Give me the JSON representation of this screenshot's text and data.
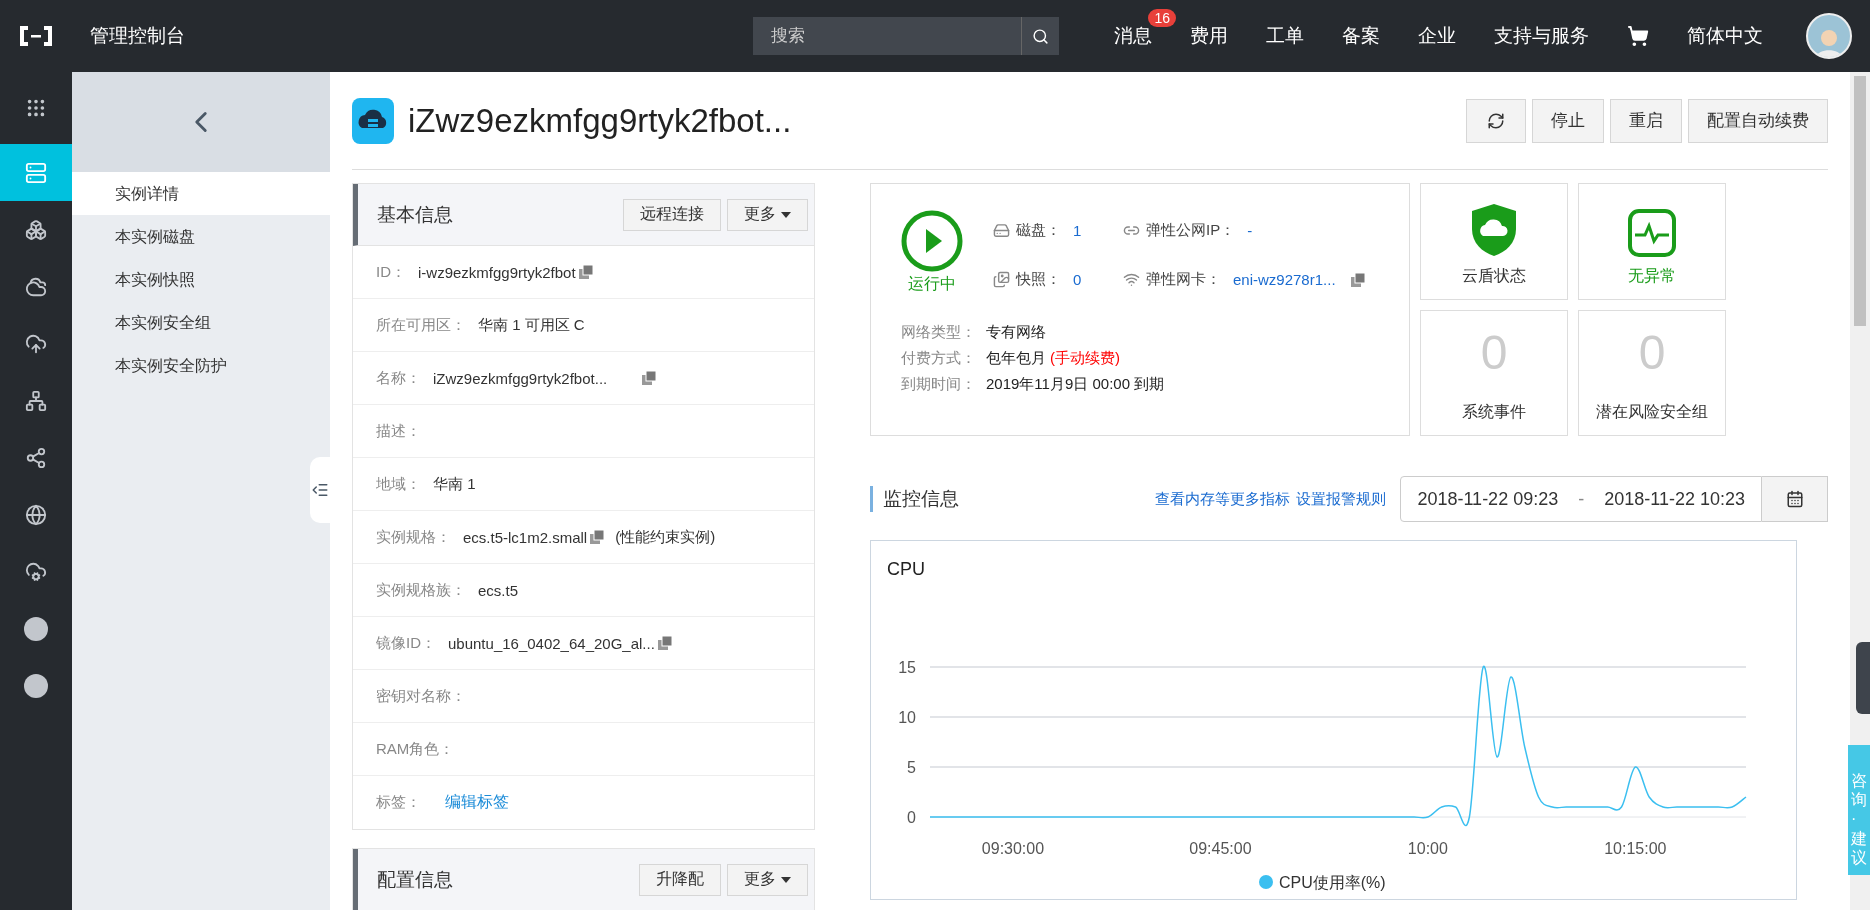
{
  "topbar": {
    "title": "管理控制台",
    "search": {
      "placeholder": "搜索"
    },
    "nav": [
      {
        "label": "消息",
        "badge": "16"
      },
      {
        "label": "费用"
      },
      {
        "label": "工单"
      },
      {
        "label": "备案"
      },
      {
        "label": "企业"
      },
      {
        "label": "支持与服务"
      }
    ],
    "language": "简体中文"
  },
  "rail": [
    {
      "kind": "grid",
      "selected": false
    },
    {
      "kind": "server",
      "selected": true
    },
    {
      "kind": "boxes",
      "selected": false
    },
    {
      "kind": "cloud",
      "selected": false
    },
    {
      "kind": "cloud-upload",
      "selected": false
    },
    {
      "kind": "network",
      "selected": false
    },
    {
      "kind": "share",
      "selected": false
    },
    {
      "kind": "globe",
      "selected": false
    },
    {
      "kind": "cloud-gear",
      "selected": false
    },
    {
      "kind": "circle",
      "selected": false
    },
    {
      "kind": "circle",
      "selected": false
    }
  ],
  "subnav": {
    "items": [
      {
        "label": "实例详情",
        "selected": true
      },
      {
        "label": "本实例磁盘",
        "selected": false
      },
      {
        "label": "本实例快照",
        "selected": false
      },
      {
        "label": "本实例安全组",
        "selected": false
      },
      {
        "label": "本实例安全防护",
        "selected": false
      }
    ]
  },
  "instance": {
    "title": "iZwz9ezkmfgg9rtyk2fbot...",
    "actions": [
      "停止",
      "重启",
      "配置自动续费"
    ]
  },
  "basic_info": {
    "title": "基本信息",
    "actions": [
      {
        "label": "远程连接",
        "caret": false
      },
      {
        "label": "更多",
        "caret": true
      }
    ],
    "rows": [
      {
        "label": "ID：",
        "value": "i-wz9ezkmfgg9rtyk2fbot",
        "kind": "text",
        "copy": true
      },
      {
        "label": "所在可用区：",
        "value": "华南 1 可用区 C",
        "kind": "text",
        "copy": false
      },
      {
        "label": "名称：",
        "value": "iZwz9ezkmfgg9rtyk2fbot...",
        "kind": "text",
        "copy": true
      },
      {
        "label": "描述：",
        "kind": "text",
        "copy": false
      },
      {
        "label": "地域：",
        "value": "华南 1",
        "kind": "text",
        "copy": false
      },
      {
        "label": "实例规格：",
        "value": "ecs.t5-lc1m2.small",
        "suffix": "(性能约束实例)",
        "kind": "text",
        "copy": true
      },
      {
        "label": "实例规格族：",
        "value": "ecs.t5",
        "kind": "text",
        "copy": false
      },
      {
        "label": "镜像ID：",
        "value": "ubuntu_16_0402_64_20G_al...",
        "kind": "text",
        "copy": true
      },
      {
        "label": "密钥对名称：",
        "kind": "text",
        "copy": false
      },
      {
        "label": "RAM角色：",
        "kind": "text",
        "copy": false
      },
      {
        "label": "标签：",
        "value": "编辑标签",
        "kind": "link",
        "copy": false
      }
    ]
  },
  "config_info": {
    "title": "配置信息",
    "actions": [
      {
        "label": "升降配",
        "caret": false
      },
      {
        "label": "更多",
        "caret": true
      }
    ]
  },
  "status": {
    "state": "运行中",
    "running": true,
    "resources": [
      {
        "kind": "disk",
        "label": "磁盘：",
        "value": "1",
        "copy": false
      },
      {
        "kind": "link",
        "label": "弹性公网IP：",
        "value": "-",
        "copy": false
      },
      {
        "kind": "snapshot",
        "label": "快照：",
        "value": "0",
        "copy": false
      },
      {
        "kind": "nic",
        "label": "弹性网卡：",
        "value": "eni-wz9278r1...",
        "copy": true
      }
    ],
    "details": [
      {
        "label": "网络类型：",
        "value": "专有网络"
      },
      {
        "label": "付费方式：",
        "value": "包年包月",
        "note": "(手动续费)"
      },
      {
        "label": "到期时间：",
        "value": "2019年11月9日 00:00 到期"
      }
    ]
  },
  "tiles": [
    {
      "kind": "shield",
      "label": "云盾状态",
      "color": "#333333"
    },
    {
      "kind": "pulse",
      "label": "无异常",
      "color": "#1a9c1a"
    },
    {
      "kind": "count",
      "count": "0",
      "label": "系统事件",
      "color": "#333333"
    },
    {
      "kind": "count",
      "count": "0",
      "label": "潜在风险安全组",
      "color": "#333333"
    }
  ],
  "monitor": {
    "title": "监控信息",
    "links": [
      "查看内存等更多指标",
      "设置报警规则"
    ],
    "range": {
      "start": "2018-11-22 09:23",
      "separator": "-",
      "end": "2018-11-22 10:23"
    }
  },
  "cpu_card": {
    "title": "CPU",
    "chart_data": {
      "type": "line",
      "categories": [
        null,
        null,
        null,
        null,
        null,
        null,
        "09:30:00",
        null,
        null,
        null,
        null,
        null,
        null,
        null,
        null,
        null,
        null,
        null,
        null,
        null,
        null,
        "09:45:00",
        null,
        null,
        null,
        null,
        null,
        null,
        null,
        null,
        null,
        null,
        null,
        null,
        null,
        null,
        "10:00",
        null,
        null,
        null,
        null,
        null,
        null,
        null,
        null,
        null,
        null,
        null,
        null,
        null,
        null,
        "10:15:00",
        null,
        null,
        null,
        null,
        null,
        null,
        null,
        null
      ],
      "series": [
        {
          "name": "CPU使用率(%)",
          "color": "#3bbff0",
          "values": [
            0,
            0,
            0,
            0,
            0,
            0,
            0,
            0,
            0,
            0,
            0,
            0,
            0,
            0,
            0,
            0,
            0,
            0,
            0,
            0,
            0,
            0,
            0,
            0,
            0,
            0,
            0,
            0,
            0,
            0,
            0,
            0,
            0,
            0,
            0,
            0,
            0,
            1,
            1,
            0,
            15,
            6,
            14,
            7,
            2,
            1,
            1,
            1,
            1,
            1,
            1,
            5,
            2,
            1,
            1,
            1,
            1,
            1,
            1,
            2
          ]
        }
      ],
      "ylim": [
        0,
        15
      ],
      "yticks": [
        0,
        5,
        10,
        15
      ]
    }
  },
  "side_tab": {
    "label": "咨询·建议"
  }
}
